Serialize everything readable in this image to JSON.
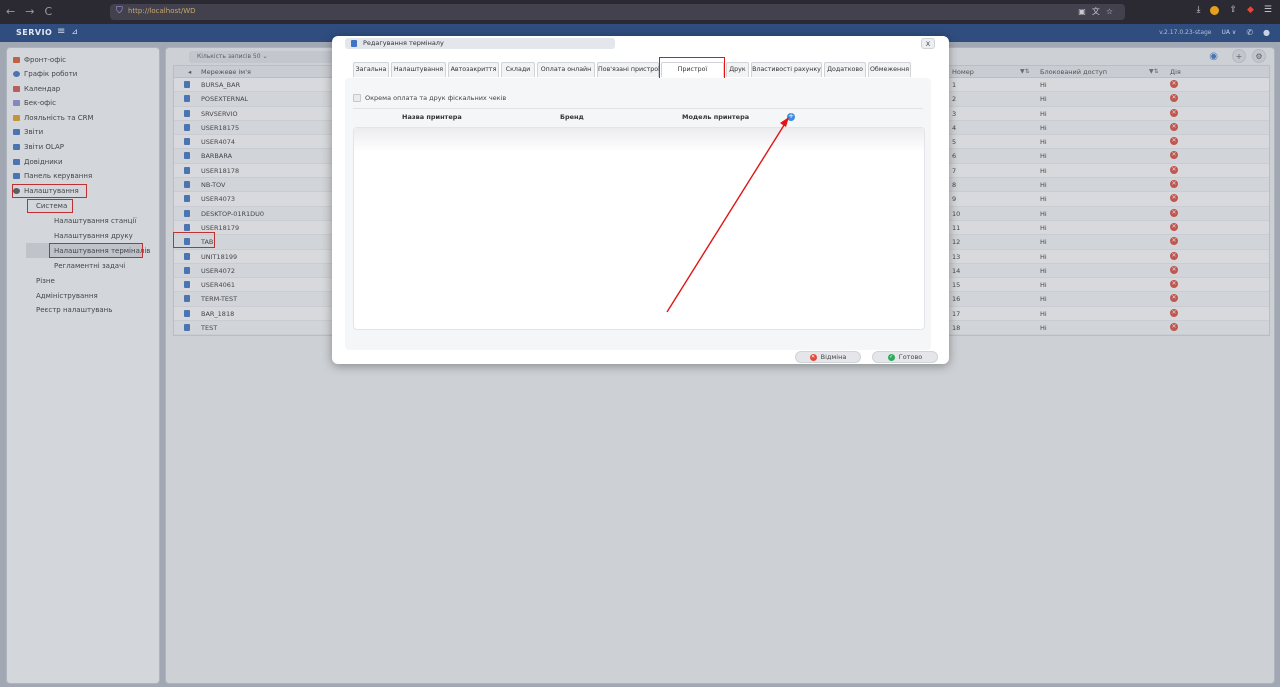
{
  "browser": {
    "url": "http://localhost/WD",
    "nav_back": "←",
    "nav_forward": "→",
    "nav_reload": "C"
  },
  "header": {
    "logo": "SERVIO",
    "version": "v.2.17.0.23-stage",
    "lang": "UA ∨"
  },
  "sidebar": {
    "items": [
      {
        "label": "Фронт-офіс",
        "color": "#e0582e"
      },
      {
        "label": "Графік роботи",
        "color": "#3e73c6"
      },
      {
        "label": "Календар",
        "color": "#d9534f"
      },
      {
        "label": "Бек-офіс",
        "color": "#8a8fd8"
      },
      {
        "label": "Лояльність та CRM",
        "color": "#e5a11b"
      },
      {
        "label": "Звіти",
        "color": "#3e73c6"
      },
      {
        "label": "Звіти OLAP",
        "color": "#3e73c6"
      },
      {
        "label": "Довідники",
        "color": "#3e73c6"
      },
      {
        "label": "Панель керування",
        "color": "#3e73c6"
      },
      {
        "label": "Налаштування",
        "color": "#555555"
      }
    ],
    "system": "Система",
    "system_items": [
      "Налаштування станції",
      "Налаштування друку",
      "Налаштування терміналів",
      "Регламентні задачі"
    ],
    "other_items": [
      "Різне",
      "Адміністрування",
      "Реєстр налаштувань"
    ]
  },
  "main": {
    "count_label": "Кількість записів 50 ⌄",
    "col_network_name": "Мережеве ім'я",
    "col_number": "Номер",
    "col_blocked": "Блокований доступ",
    "col_action": "Дія",
    "rows": [
      {
        "name": "BURSA_BAR",
        "num": "1",
        "blocked": "Ні"
      },
      {
        "name": "POSEXTERNAL",
        "num": "2",
        "blocked": "Ні"
      },
      {
        "name": "SRVSERVIO",
        "num": "3",
        "blocked": "Ні"
      },
      {
        "name": "USER18175",
        "num": "4",
        "blocked": "Ні"
      },
      {
        "name": "USER4074",
        "num": "5",
        "blocked": "Ні"
      },
      {
        "name": "BARBARA",
        "num": "6",
        "blocked": "Ні"
      },
      {
        "name": "USER18178",
        "num": "7",
        "blocked": "Ні"
      },
      {
        "name": "NB-TOV",
        "num": "8",
        "blocked": "Ні"
      },
      {
        "name": "USER4073",
        "num": "9",
        "blocked": "Ні"
      },
      {
        "name": "DESKTOP-01R1DU0",
        "num": "10",
        "blocked": "Ні"
      },
      {
        "name": "USER18179",
        "num": "11",
        "blocked": "Ні"
      },
      {
        "name": "TAB",
        "num": "12",
        "blocked": "Ні"
      },
      {
        "name": "UNIT18199",
        "num": "13",
        "blocked": "Ні"
      },
      {
        "name": "USER4072",
        "num": "14",
        "blocked": "Ні"
      },
      {
        "name": "USER4061",
        "num": "15",
        "blocked": "Ні"
      },
      {
        "name": "TERM-TEST",
        "num": "16",
        "blocked": "Ні"
      },
      {
        "name": "BAR_1818",
        "num": "17",
        "blocked": "Ні"
      },
      {
        "name": "TEST",
        "num": "18",
        "blocked": "Ні"
      }
    ]
  },
  "modal": {
    "title": "Редагування терміналу",
    "close": "X",
    "tabs": [
      "Загальна",
      "Налаштування",
      "Автозакриття",
      "Склади",
      "Оплата онлайн",
      "Пов'язані пристрої",
      "Пристрої",
      "Друк",
      "Властивості рахунку",
      "Додатково",
      "Обмеження"
    ],
    "checkbox_label": "Окрема оплата та друк фіскальних чеків",
    "col_printer_name": "Назва принтера",
    "col_brand": "Бренд",
    "col_model": "Модель принтера",
    "add_symbol": "+",
    "cancel_label": "Відміна",
    "done_label": "Готово"
  }
}
